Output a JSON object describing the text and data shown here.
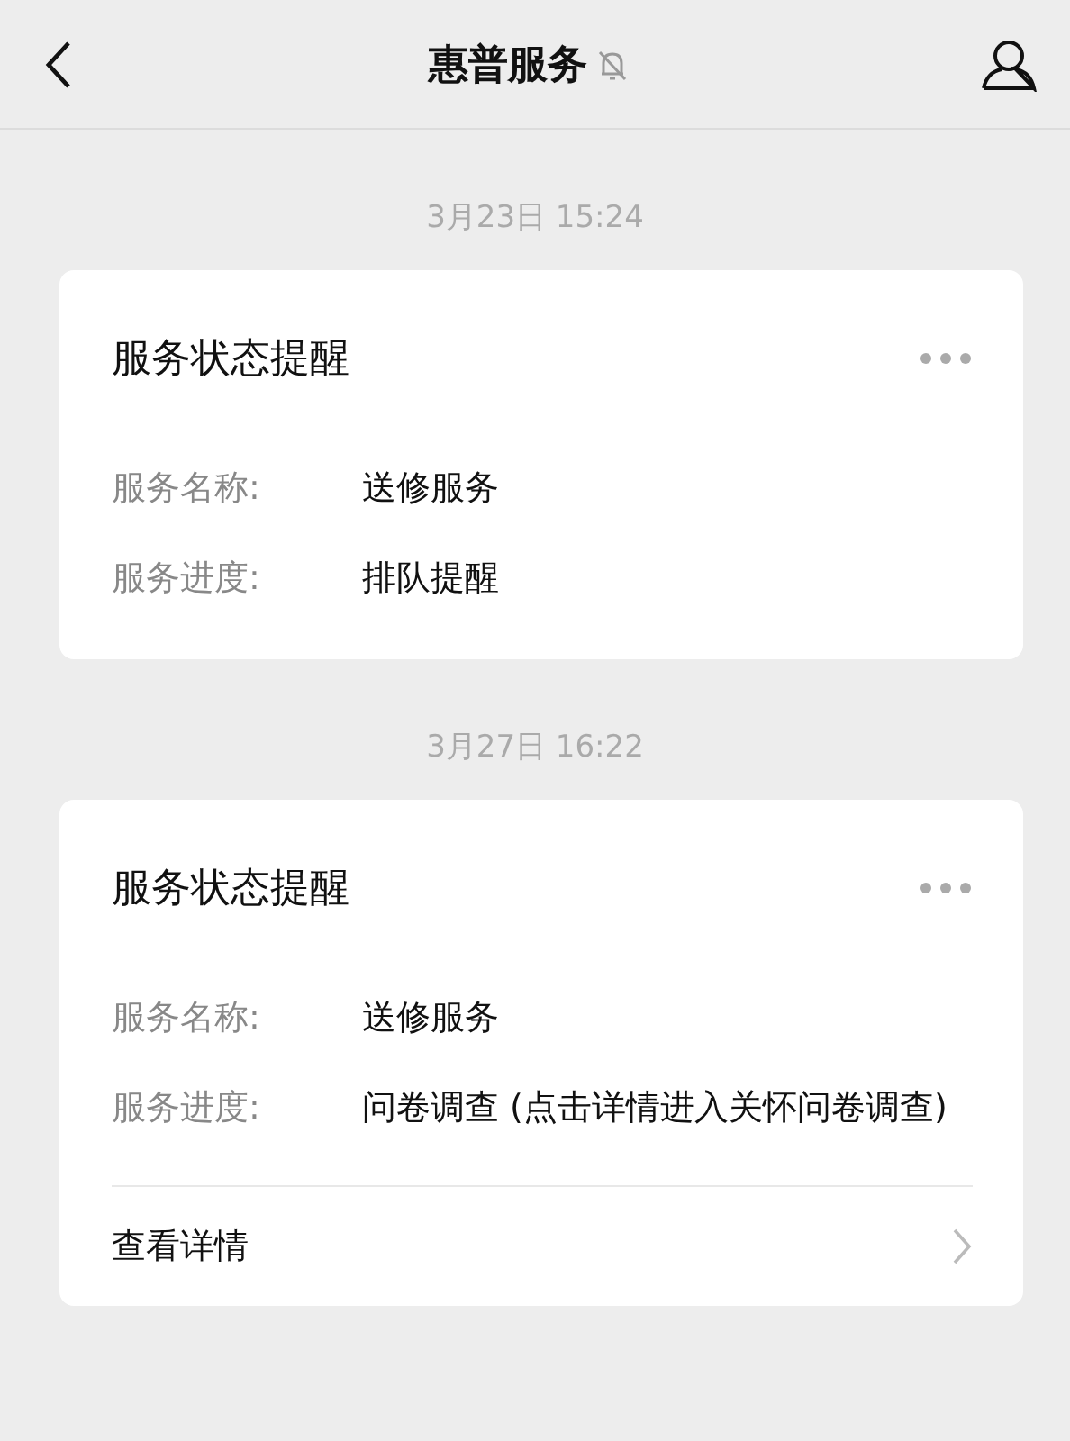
{
  "header": {
    "title": "惠普服务",
    "muted": true
  },
  "messages": [
    {
      "time": "3月23日 15:24",
      "card": {
        "title": "服务状态提醒",
        "fields": [
          {
            "label": "服务名称:",
            "value": "送修服务"
          },
          {
            "label": "服务进度:",
            "value": "排队提醒"
          }
        ]
      }
    },
    {
      "time": "3月27日 16:22",
      "card": {
        "title": "服务状态提醒",
        "fields": [
          {
            "label": "服务名称:",
            "value": "送修服务"
          },
          {
            "label": "服务进度:",
            "value": "问卷调查 (点击详情进入关怀问卷调查)"
          }
        ],
        "link": "查看详情"
      }
    }
  ]
}
